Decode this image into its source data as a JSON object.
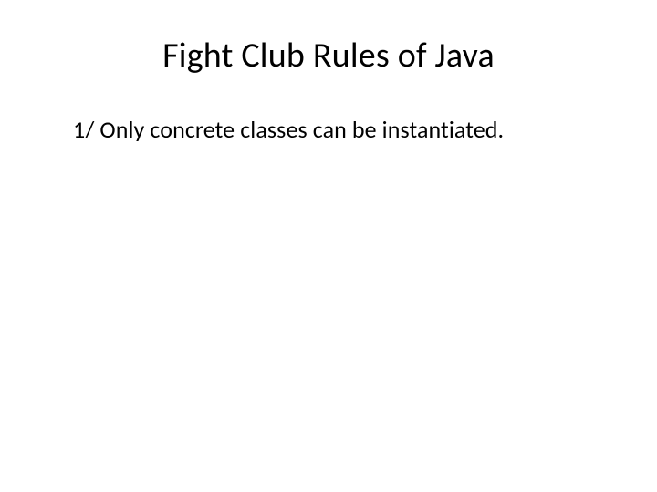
{
  "slide": {
    "title": "Fight Club Rules of Java",
    "body": "1/ Only concrete classes can be instantiated."
  }
}
